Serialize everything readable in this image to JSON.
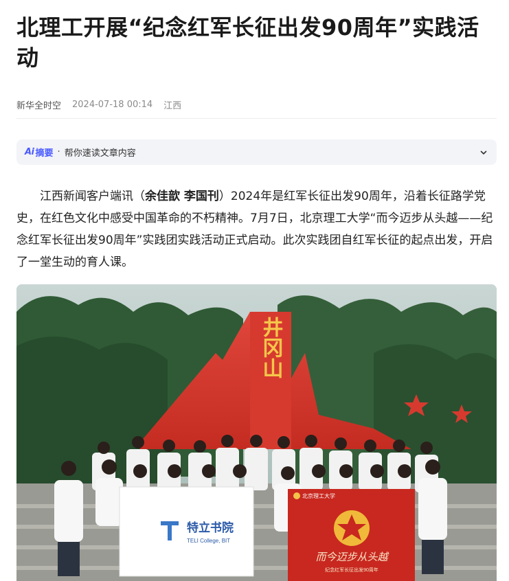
{
  "article": {
    "title": "北理工开展“纪念红军长征出发90周年”实践活动",
    "source": "新华全时空",
    "datetime": "2024-07-18 00:14",
    "region": "江西"
  },
  "summary": {
    "badge": "摘要",
    "hint": "帮你速读文章内容"
  },
  "body": {
    "p1_before": "江西新闻客户端讯（",
    "authors": "余佳歆 李国刊",
    "p1_after": "）2024年是红军长征出发90周年，沿着长征路学党史，在红色文化中感受中国革命的不朽精神。7月7日，北京理工大学“而今迈步从头越——纪念红军长征出发90周年”实践团实践活动正式启动。此次实践团自红军长征的起点出发，开启了一堂生动的育人课。"
  },
  "photo": {
    "monument_text": "井冈山",
    "banner_left_cn": "特立书院",
    "banner_left_en": "TELI College, BIT",
    "banner_right_title": "北京理工大学",
    "banner_right_slogan": "而今迈步从头越",
    "banner_right_sub": "纪念红军长征出发90周年"
  },
  "colors": {
    "monument": "#d9342b",
    "banner_red": "#c8281f",
    "ai_blue": "#4a5bff"
  }
}
